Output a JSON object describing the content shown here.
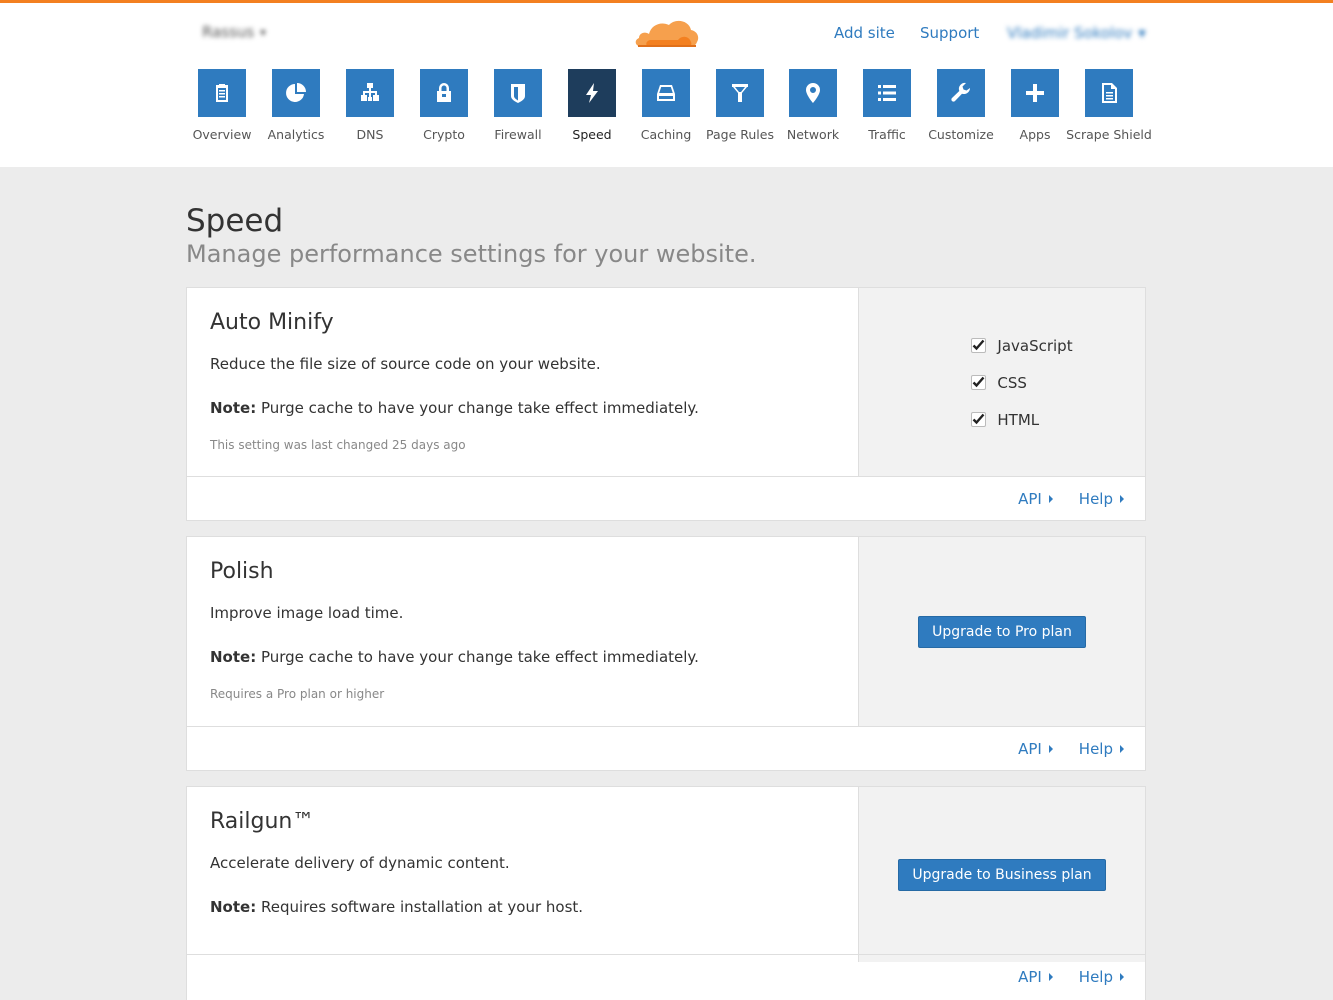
{
  "header": {
    "account_name": "Rassus",
    "add_site": "Add site",
    "support": "Support",
    "user_name": "Vladimir Sokolov",
    "accent_color": "#f38020",
    "link_color": "#2f7bbf"
  },
  "nav": [
    {
      "label": "Overview",
      "icon": "clipboard-icon"
    },
    {
      "label": "Analytics",
      "icon": "pie-chart-icon"
    },
    {
      "label": "DNS",
      "icon": "network-tree-icon"
    },
    {
      "label": "Crypto",
      "icon": "lock-icon"
    },
    {
      "label": "Firewall",
      "icon": "shield-icon"
    },
    {
      "label": "Speed",
      "icon": "lightning-icon",
      "active": true
    },
    {
      "label": "Caching",
      "icon": "drive-icon"
    },
    {
      "label": "Page Rules",
      "icon": "filter-icon"
    },
    {
      "label": "Network",
      "icon": "location-pin-icon"
    },
    {
      "label": "Traffic",
      "icon": "list-icon"
    },
    {
      "label": "Customize",
      "icon": "wrench-icon"
    },
    {
      "label": "Apps",
      "icon": "plus-icon"
    },
    {
      "label": "Scrape Shield",
      "icon": "document-icon"
    }
  ],
  "page": {
    "title": "Speed",
    "subtitle": "Manage performance settings for your website."
  },
  "cards": {
    "auto_minify": {
      "title": "Auto Minify",
      "description": "Reduce the file size of source code on your website.",
      "note_label": "Note:",
      "note_text": " Purge cache to have your change take effect immediately.",
      "meta": "This setting was last changed 25 days ago",
      "options": [
        {
          "label": "JavaScript",
          "checked": true
        },
        {
          "label": "CSS",
          "checked": true
        },
        {
          "label": "HTML",
          "checked": true
        }
      ],
      "api": "API",
      "help": "Help"
    },
    "polish": {
      "title": "Polish",
      "description": "Improve image load time.",
      "note_label": "Note:",
      "note_text": " Purge cache to have your change take effect immediately.",
      "meta": "Requires a Pro plan or higher",
      "button": "Upgrade to Pro plan",
      "api": "API",
      "help": "Help"
    },
    "railgun": {
      "title": "Railgun™",
      "description": "Accelerate delivery of dynamic content.",
      "note_label": "Note:",
      "note_text": " Requires software installation at your host.",
      "button": "Upgrade to Business plan",
      "api": "API",
      "help": "Help"
    }
  }
}
